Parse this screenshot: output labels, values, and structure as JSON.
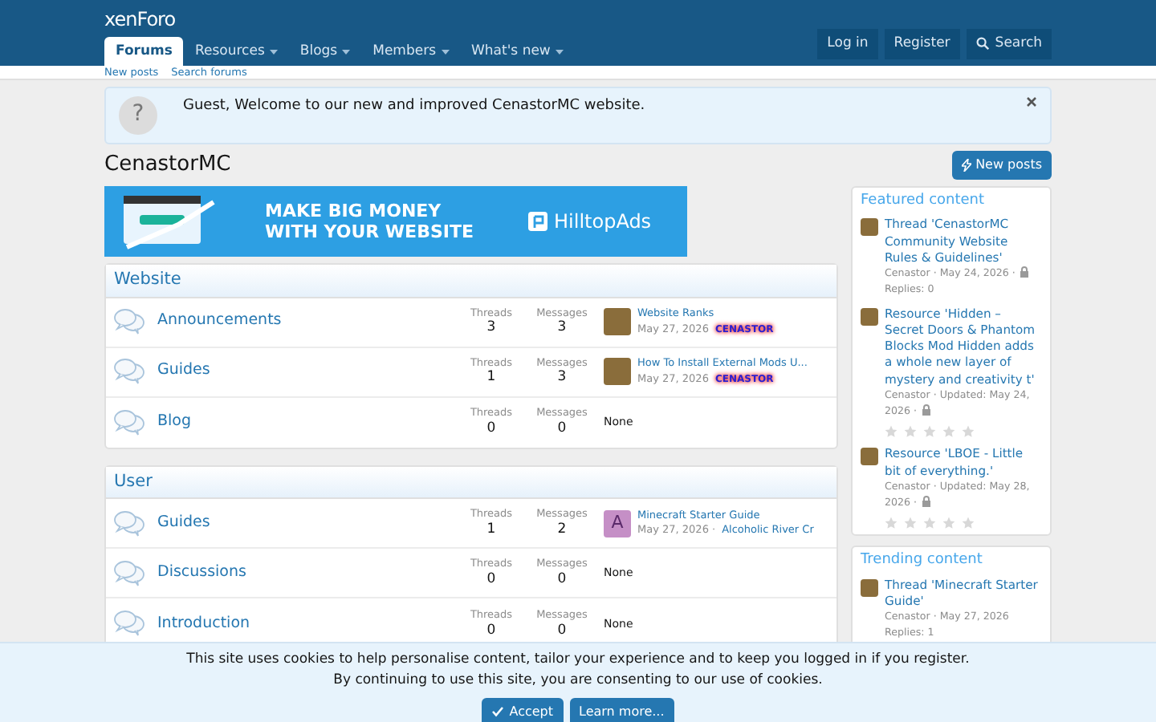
{
  "header": {
    "logo": "xenForo",
    "tabs": [
      {
        "label": "Forums",
        "selected": true,
        "has_menu": false
      },
      {
        "label": "Resources",
        "selected": false,
        "has_menu": true
      },
      {
        "label": "Blogs",
        "selected": false,
        "has_menu": true
      },
      {
        "label": "Members",
        "selected": false,
        "has_menu": true
      },
      {
        "label": "What's new",
        "selected": false,
        "has_menu": true
      }
    ],
    "account": [
      "Log in",
      "Register"
    ],
    "search": "Search",
    "subnav": [
      "New posts",
      "Search forums"
    ]
  },
  "notice": {
    "icon": "?",
    "text": "Guest, Welcome to our new and improved CenastorMC website."
  },
  "page": {
    "title": "CenastorMC",
    "new_posts": "New posts"
  },
  "banner": {
    "headline": "MAKE BIG MONEY WITH YOUR WEBSITE",
    "brand": "HilltopAds"
  },
  "categories": [
    {
      "title": "Website",
      "forums": [
        {
          "title": "Announcements",
          "threads_label": "Threads",
          "threads": "3",
          "messages_label": "Messages",
          "messages": "3",
          "last_post": {
            "avatar": {
              "kind": "photo"
            },
            "title": "Website Ranks",
            "date": "May 27, 2026",
            "user": {
              "kind": "banner",
              "name": "CENASTOR"
            }
          }
        },
        {
          "title": "Guides",
          "threads_label": "Threads",
          "threads": "1",
          "messages_label": "Messages",
          "messages": "3",
          "last_post": {
            "avatar": {
              "kind": "photo"
            },
            "title": "How To Install External Mods U...",
            "date": "May 27, 2026",
            "user": {
              "kind": "banner",
              "name": "CENASTOR"
            }
          }
        },
        {
          "title": "Blog",
          "threads_label": "Threads",
          "threads": "0",
          "messages_label": "Messages",
          "messages": "0",
          "none": "None"
        }
      ]
    },
    {
      "title": "User",
      "forums": [
        {
          "title": "Guides",
          "threads_label": "Threads",
          "threads": "1",
          "messages_label": "Messages",
          "messages": "2",
          "last_post": {
            "avatar": {
              "kind": "letter",
              "letter": "A"
            },
            "title": "Minecraft Starter Guide",
            "date": "May 27, 2026 ·",
            "user": {
              "kind": "link",
              "name": "Alcoholic River Cr"
            }
          }
        },
        {
          "title": "Discussions",
          "threads_label": "Threads",
          "threads": "0",
          "messages_label": "Messages",
          "messages": "0",
          "none": "None"
        },
        {
          "title": "Introduction",
          "threads_label": "Threads",
          "threads": "0",
          "messages_label": "Messages",
          "messages": "0",
          "none": "None"
        }
      ]
    }
  ],
  "sidebar": [
    {
      "title": "Featured content",
      "items": [
        {
          "title": "Thread 'CenastorMC Community Website Rules & Guidelines'",
          "meta": "Cenastor · May 24, 2026 ·",
          "locked": true,
          "extra": "Replies: 0"
        },
        {
          "title": "Resource 'Hidden – Secret Doors & Phantom Blocks Mod Hidden adds a whole new layer of mystery and creativity t'",
          "meta": "Cenastor · Updated: May 24, 2026 ·",
          "locked": true,
          "stars": 0
        },
        {
          "title": "Resource 'LBOE - Little bit of everything.'",
          "meta": "Cenastor · Updated: May 28, 2026 ·",
          "locked": true,
          "stars": 0
        }
      ]
    },
    {
      "title": "Trending content",
      "items": [
        {
          "title": "Thread 'Minecraft Starter Guide'",
          "meta": "Cenastor · May 27, 2026",
          "locked": false,
          "extra": "Replies: 1"
        }
      ]
    }
  ],
  "cookie": {
    "lines": [
      "This site uses cookies to help personalise content, tailor your experience and to keep you logged in if you register.",
      "By continuing to use this site, you are consenting to our use of cookies."
    ],
    "accept": "Accept",
    "learn_more": "Learn more..."
  }
}
